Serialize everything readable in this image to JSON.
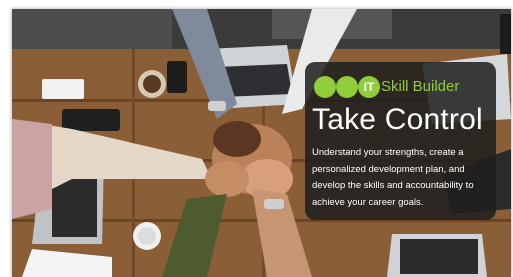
{
  "banner": {
    "logo": {
      "badge_text": "IT",
      "brand_text": "Skill Builder"
    },
    "headline": "Take Control",
    "description": "Understand your strengths, create a personalized development plan, and develop the skills and accountability to achieve your career goals.",
    "colors": {
      "brand_green": "#8fce3a",
      "card_background": "#1e1e1e",
      "table_wood": "#7a5230"
    }
  }
}
